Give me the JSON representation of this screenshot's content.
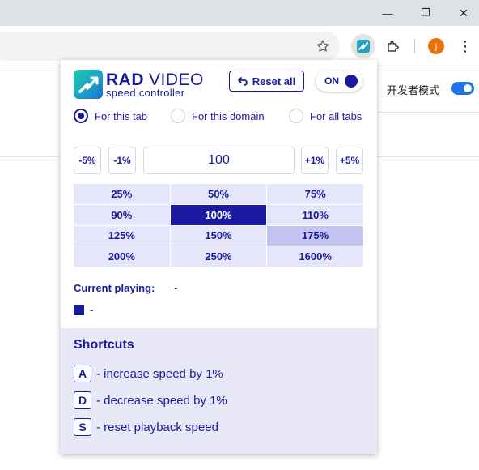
{
  "browser": {
    "window_controls": {
      "minimize_glyph": "—",
      "restore_glyph": "❐",
      "close_glyph": "✕"
    },
    "toolbar": {
      "avatar_letter": "j",
      "more_glyph": "⋮"
    },
    "page": {
      "developer_mode_label": "开发者模式"
    }
  },
  "popup": {
    "brand": {
      "rad": "RAD",
      "video": "VIDEO",
      "subtitle": "speed controller"
    },
    "reset_all_label": "Reset all",
    "toggle_label": "ON",
    "scope_options": [
      {
        "label": "For this tab",
        "checked": true
      },
      {
        "label": "For this domain",
        "checked": false
      },
      {
        "label": "For all tabs",
        "checked": false
      }
    ],
    "steps": {
      "minus5": "-5%",
      "minus1": "-1%",
      "plus1": "+1%",
      "plus5": "+5%"
    },
    "speed_value": "100",
    "presets": [
      "25%",
      "50%",
      "75%",
      "90%",
      "100%",
      "110%",
      "125%",
      "150%",
      "175%",
      "200%",
      "250%",
      "1600%"
    ],
    "active_preset": "100%",
    "hovered_preset": "175%",
    "current_playing_label": "Current playing:",
    "current_playing_value": "-",
    "media_value": "-",
    "shortcuts": {
      "title": "Shortcuts",
      "items": [
        {
          "key": "A",
          "text": "- increase speed by 1%"
        },
        {
          "key": "D",
          "text": "- decrease speed by 1%"
        },
        {
          "key": "S",
          "text": "- reset playback speed"
        }
      ]
    }
  },
  "colors": {
    "brand_navy": "#1a1aa0",
    "preset_bg": "#e6e6fb",
    "preset_hover": "#c4c4f2",
    "shortcuts_bg": "#e8e8f6",
    "chrome_blue": "#1a73e8"
  }
}
